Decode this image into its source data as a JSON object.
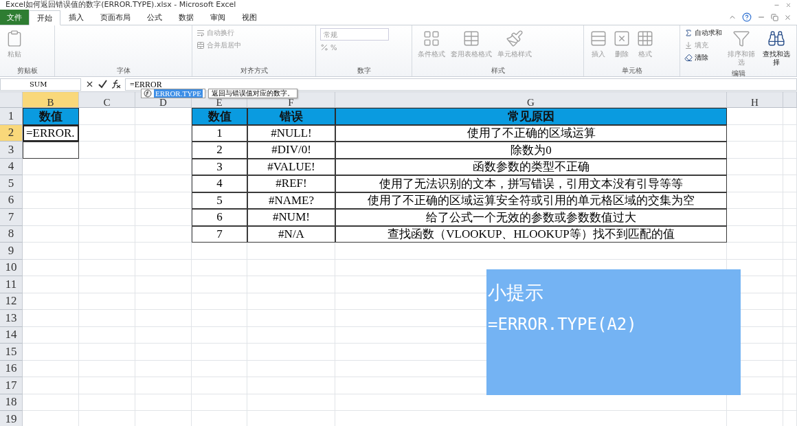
{
  "title": "Excel如何返回错误值的数字(ERROR.TYPE).xlsx - Microsoft Excel",
  "ribbon_tabs": [
    {
      "label": "文件",
      "selected": false,
      "kind": "file"
    },
    {
      "label": "开始",
      "selected": true,
      "kind": "tab"
    },
    {
      "label": "插入",
      "selected": false,
      "kind": "tab"
    },
    {
      "label": "页面布局",
      "selected": false,
      "kind": "tab"
    },
    {
      "label": "公式",
      "selected": false,
      "kind": "tab"
    },
    {
      "label": "数据",
      "selected": false,
      "kind": "tab"
    },
    {
      "label": "审阅",
      "selected": false,
      "kind": "tab"
    },
    {
      "label": "视图",
      "selected": false,
      "kind": "tab"
    }
  ],
  "ribbon_groups": [
    {
      "label": "剪贴板",
      "buttons": [
        {
          "label": "粘贴",
          "kind": "large",
          "disabled": true
        }
      ]
    },
    {
      "label": "字体"
    },
    {
      "label": "对齐方式",
      "buttons": [
        {
          "label": "自动换行",
          "kind": "small",
          "disabled": true
        },
        {
          "label": "合并后居中",
          "kind": "small",
          "disabled": true
        }
      ]
    },
    {
      "label": "数字",
      "buttons": [
        {
          "label": "常规",
          "kind": "dropdown",
          "disabled": true
        },
        {
          "label": "%",
          "kind": "small",
          "disabled": true
        }
      ]
    },
    {
      "label": "样式",
      "buttons": [
        {
          "label": "条件格式",
          "kind": "large",
          "disabled": true
        },
        {
          "label": "套用表格格式",
          "kind": "large",
          "disabled": true
        },
        {
          "label": "单元格样式",
          "kind": "large",
          "disabled": true
        }
      ]
    },
    {
      "label": "单元格",
      "buttons": [
        {
          "label": "插入",
          "kind": "large",
          "disabled": true
        },
        {
          "label": "删除",
          "kind": "large",
          "disabled": true
        },
        {
          "label": "格式",
          "kind": "large",
          "disabled": true
        }
      ]
    },
    {
      "label": "编辑",
      "buttons": [
        {
          "label": "自动求和",
          "kind": "small",
          "disabled": false
        },
        {
          "label": "填充",
          "kind": "small",
          "disabled": true
        },
        {
          "label": "清除",
          "kind": "small",
          "disabled": false
        },
        {
          "label": "排序和筛选",
          "kind": "large",
          "disabled": true
        },
        {
          "label": "查找和选择",
          "kind": "large",
          "disabled": false
        }
      ]
    }
  ],
  "formula_bar": {
    "name_box": "SUM",
    "formula": "=ERROR"
  },
  "autocomplete": {
    "items": [
      {
        "label": "ERROR.TYPE",
        "selected": true
      }
    ],
    "tooltip": "返回与错误值对应的数字。"
  },
  "columns": [
    {
      "label": "B",
      "selected": true
    },
    {
      "label": "C",
      "selected": false
    },
    {
      "label": "D",
      "selected": false
    },
    {
      "label": "E",
      "selected": false
    },
    {
      "label": "F",
      "selected": false
    },
    {
      "label": "G",
      "selected": false
    },
    {
      "label": "H",
      "selected": false
    }
  ],
  "rows": [
    {
      "label": "1",
      "selected": false
    },
    {
      "label": "2",
      "selected": true
    },
    {
      "label": "3",
      "selected": false
    },
    {
      "label": "4",
      "selected": false
    },
    {
      "label": "5",
      "selected": false
    },
    {
      "label": "6",
      "selected": false
    },
    {
      "label": "7",
      "selected": false
    },
    {
      "label": "8",
      "selected": false
    },
    {
      "label": "9",
      "selected": false
    },
    {
      "label": "10",
      "selected": false
    },
    {
      "label": "11",
      "selected": false
    },
    {
      "label": "12",
      "selected": false
    },
    {
      "label": "13",
      "selected": false
    },
    {
      "label": "14",
      "selected": false
    },
    {
      "label": "15",
      "selected": false
    },
    {
      "label": "16",
      "selected": false
    },
    {
      "label": "17",
      "selected": false
    },
    {
      "label": "18",
      "selected": false
    },
    {
      "label": "19",
      "selected": false
    }
  ],
  "column_b": [
    {
      "text": "数值",
      "kind": "header"
    },
    {
      "text": "=ERROR.",
      "kind": "editing"
    },
    {
      "kind": "bordered"
    }
  ],
  "error_table": {
    "columns": [
      "数值",
      "错误",
      "常见原因"
    ],
    "rows": [
      [
        "1",
        "#NULL!",
        "使用了不正确的区域运算"
      ],
      [
        "2",
        "#DIV/0!",
        "除数为0"
      ],
      [
        "3",
        "#VALUE!",
        "函数参数的类型不正确"
      ],
      [
        "4",
        "#REF!",
        "使用了无法识别的文本，拼写错误，引用文本没有引导等等"
      ],
      [
        "5",
        "#NAME?",
        "使用了不正确的区域运算安全符或引用的单元格区域的交集为空"
      ],
      [
        "6",
        "#NUM!",
        "给了公式一个无效的参数或参数数值过大"
      ],
      [
        "7",
        "#N/A",
        "查找函数（VLOOKUP、HLOOKUP等）找不到匹配的值"
      ]
    ]
  },
  "tip_box": {
    "title": "小提示",
    "text": "=ERROR.TYPE(A2)"
  }
}
